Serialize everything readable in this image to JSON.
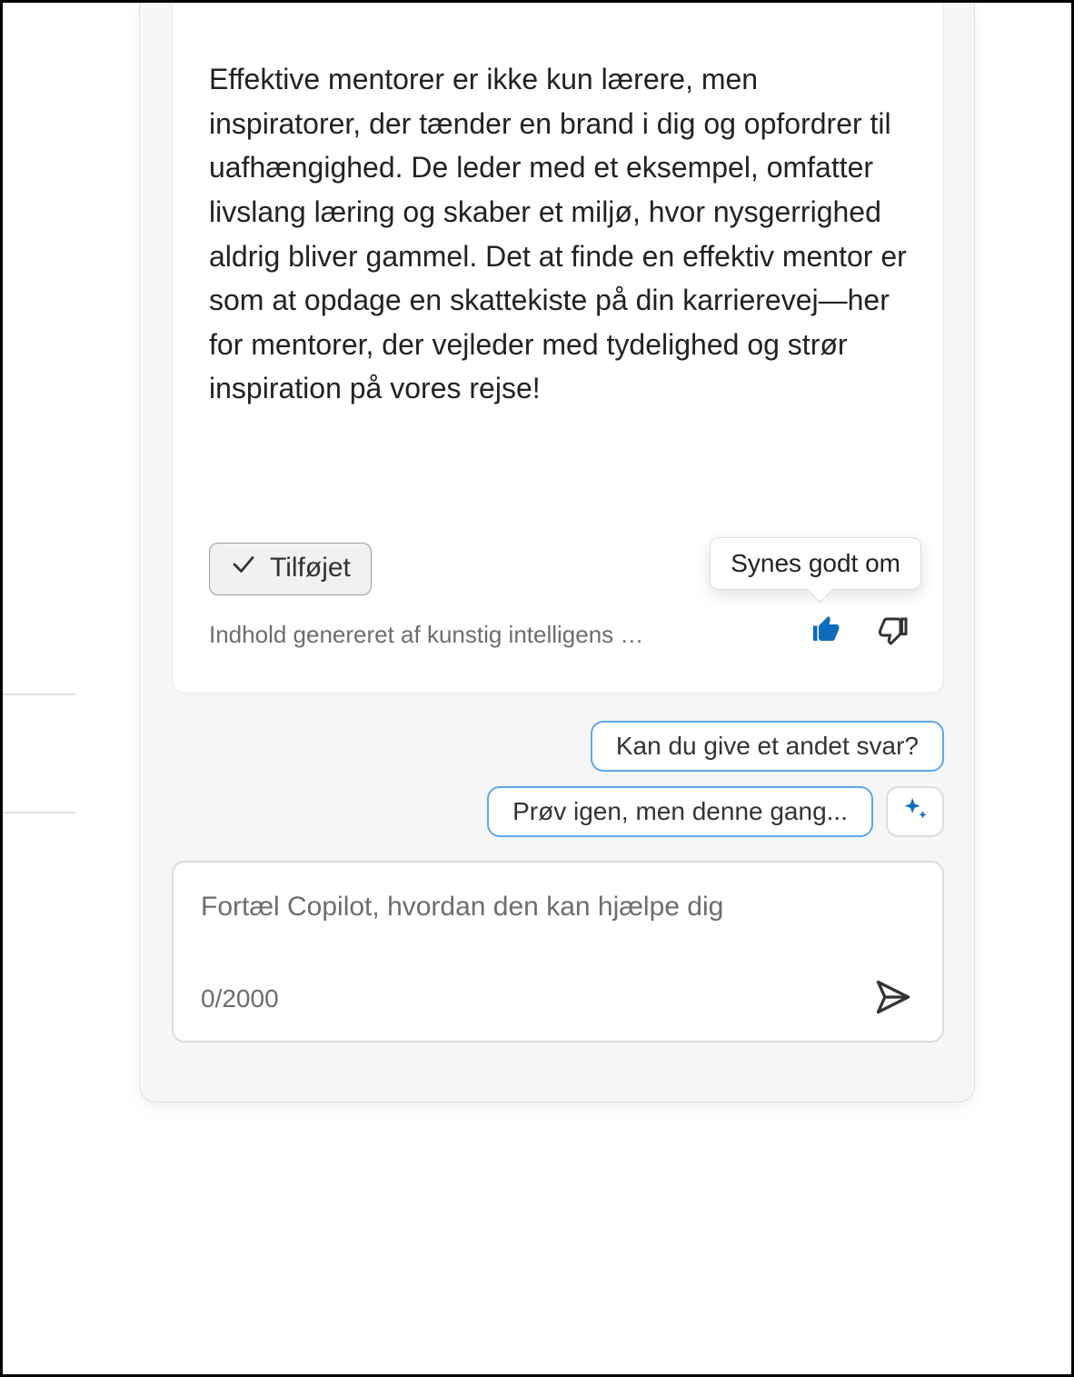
{
  "response": {
    "body": "Effektive mentorer er ikke kun lærere, men inspiratorer, der tænder en brand i dig og opfordrer til uafhængighed. De leder med et eksempel, omfatter livslang læring og skaber et miljø, hvor nysgerrighed aldrig bliver gammel. Det at finde en effektiv mentor er som at opdage en skattekiste på din karrierevej—her for mentorer, der vejleder med tydelighed og strør inspiration på vores rejse!",
    "added_label": "Tilføjet",
    "disclaimer": "Indhold genereret af kunstig intelligens ka...",
    "tooltip_like": "Synes godt om"
  },
  "suggestions": {
    "s1": "Kan du give et andet svar?",
    "s2": "Prøv igen, men denne gang..."
  },
  "input": {
    "placeholder": "Fortæl Copilot, hvordan den kan hjælpe dig",
    "char_count": "0/2000"
  },
  "colors": {
    "accent": "#0f6cbd",
    "chip_border": "#5ea7e6"
  }
}
